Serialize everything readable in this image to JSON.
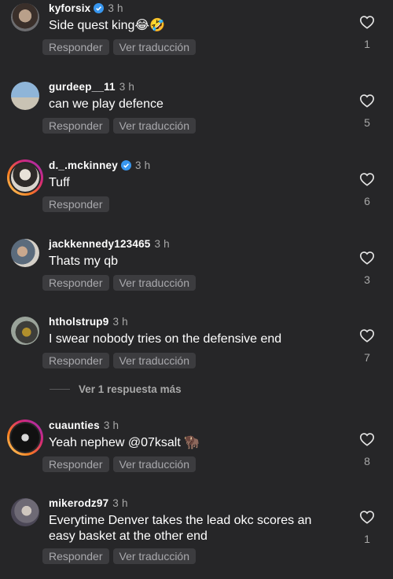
{
  "actions": {
    "reply": "Responder",
    "translate": "Ver traducción"
  },
  "comments": [
    {
      "username": "kyforsix",
      "verified": true,
      "time": "3 h",
      "text": "Side quest king😂🤣",
      "likes": "1",
      "has_translate": true
    },
    {
      "username": "gurdeep__11",
      "verified": false,
      "time": "3 h",
      "text": "can we play defence",
      "likes": "5",
      "has_translate": true
    },
    {
      "username": "d._.mckinney",
      "verified": true,
      "time": "3 h",
      "text": "Tuff",
      "likes": "6",
      "has_translate": false
    },
    {
      "username": "jackkennedy123465",
      "verified": false,
      "time": "3 h",
      "text": "Thats my qb",
      "likes": "3",
      "has_translate": true
    },
    {
      "username": "htholstrup9",
      "verified": false,
      "time": "3 h",
      "text": "I swear nobody tries on the defensive end",
      "likes": "7",
      "has_translate": true
    },
    {
      "username": "cuaunties",
      "verified": false,
      "time": "3 h",
      "text": "Yeah nephew @07ksalt 🦬",
      "likes": "8",
      "has_translate": true
    },
    {
      "username": "mikerodz97",
      "verified": false,
      "time": "3 h",
      "text": "Everytime Denver takes the lead okc scores an easy basket at the other end",
      "likes": "1",
      "has_translate": true
    }
  ],
  "more_replies": "Ver 1 respuesta más",
  "colors": {
    "background": "#262628",
    "pill": "#3c3c3f",
    "verified": "#3897f0",
    "muted": "#a8a8a8"
  }
}
